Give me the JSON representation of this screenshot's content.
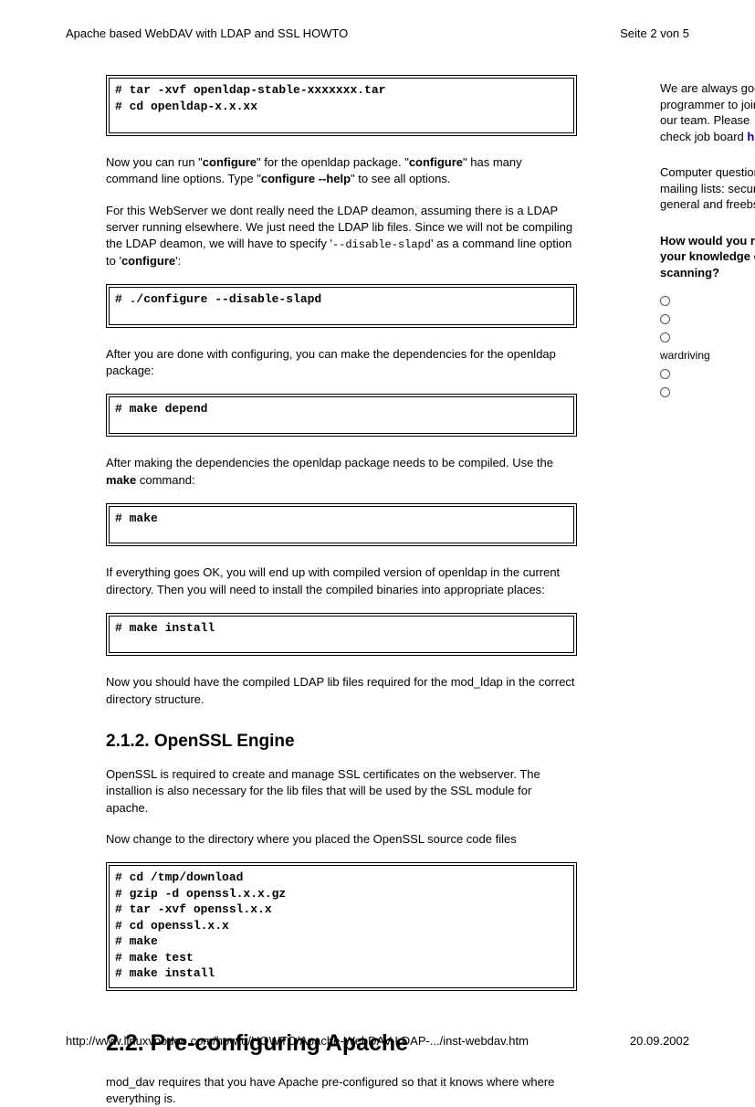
{
  "header": {
    "title": "Apache based WebDAV with LDAP and SSL HOWTO",
    "pagenum": "Seite 2 von 5"
  },
  "code": {
    "c1": "# tar -xvf openldap-stable-xxxxxxx.tar\n# cd openldap-x.x.xx",
    "c2": "# ./configure --disable-slapd",
    "c3": "# make depend",
    "c4": "# make",
    "c5": "# make install",
    "c6": "# cd /tmp/download\n# gzip -d openssl.x.x.gz\n# tar -xvf openssl.x.x\n# cd openssl.x.x\n# make\n# make test\n# make install"
  },
  "para": {
    "p1a": "Now you can run \"",
    "p1b": "configure",
    "p1c": "\" for the openldap package. \"",
    "p1d": "configure",
    "p1e": "\" has many command line options. Type \"",
    "p1f": "configure --help",
    "p1g": "\" to see all options.",
    "p2a": "For this WebServer we dont really need the LDAP deamon, assuming there is a LDAP server running elsewhere. We just need the LDAP lib files. Since we will not be compiling the LDAP deamon, we will have to specify '",
    "p2b": "--disable-slapd",
    "p2c": "' as a command line option to '",
    "p2d": "configure",
    "p2e": "':",
    "p3": "After you are done with configuring, you can make the dependencies for the openldap package:",
    "p4a": "After making the dependencies the openldap package needs to be compiled. Use the ",
    "p4b": "make",
    "p4c": " command:",
    "p5": "If everything goes OK, you will end up with compiled version of openldap in the current directory. Then you will need to install the compiled binaries into appropriate places:",
    "p6": "Now you should have the compiled LDAP lib files required for the mod_ldap in the correct directory structure.",
    "h212": "2.1.2. OpenSSL Engine",
    "p7": "OpenSSL is required to create and manage SSL certificates on the webserver. The installion is also necessary for the lib files that will be used by the SSL module for apache.",
    "p8": "Now change to the directory where you placed the OpenSSL source code files",
    "h22": "2.2. Pre-configuring Apache",
    "p9": "mod_dav requires that you have Apache pre-configured so that it knows where where everything is."
  },
  "sidebar": {
    "s1a": "We are always good programmer to join our team. Please check job board ",
    "s1b": "here",
    "s2": "Computer questions mailing lists: security, general and freebsd.",
    "qhead": "How would you rate your knowledge of scanning?",
    "opt_wardriving": "wardriving"
  },
  "footer": {
    "url": "http://www.linuxvoodoo.com/howto/HOWTO/Apache-WebDAV-LDAP-.../inst-webdav.htm",
    "date": "20.09.2002"
  }
}
